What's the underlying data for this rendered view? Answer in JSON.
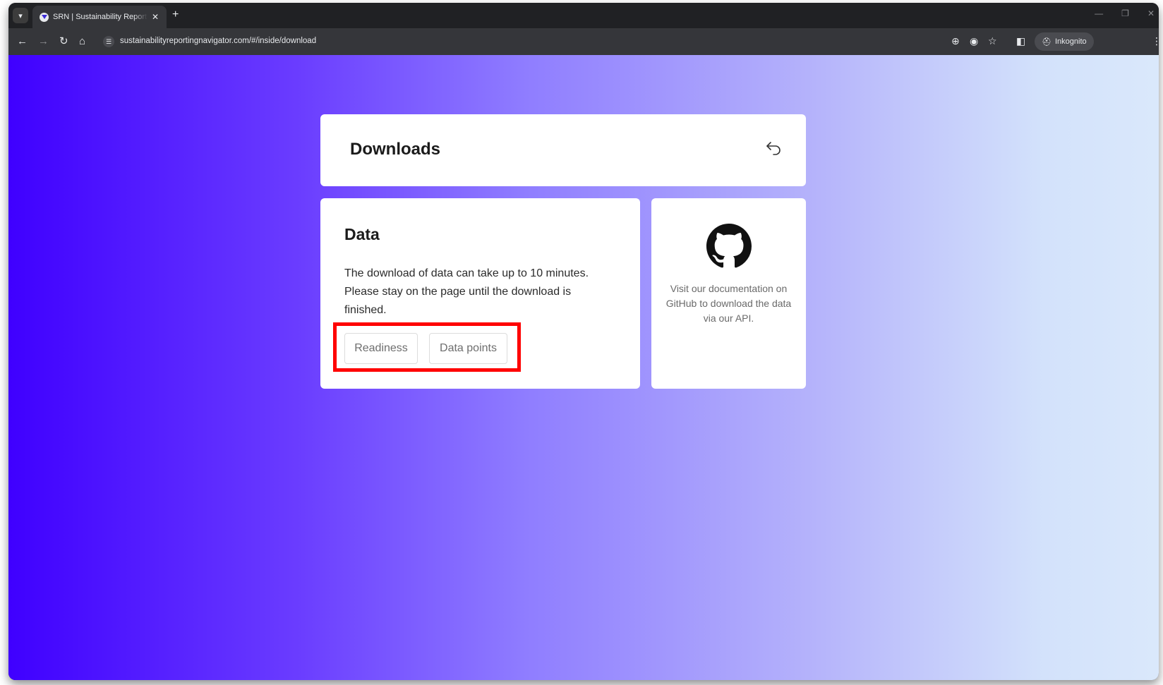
{
  "browser": {
    "tab": {
      "title": "SRN | Sustainability Reporting N",
      "close": "✕"
    },
    "new_tab": "+",
    "url": "sustainabilityreportingnavigator.com/#/inside/download",
    "incognito_label": "Inkognito",
    "icons": {
      "tab_menu": "chevron-down-icon",
      "back": "back-arrow-icon",
      "forward": "forward-arrow-icon",
      "reload": "reload-icon",
      "home": "home-icon",
      "site_info": "site-info-icon",
      "zoom": "zoom-icon",
      "eye": "eye-icon",
      "bookmark": "star-icon",
      "side_panel": "side-panel-icon",
      "incognito": "incognito-icon",
      "menu": "more-vertical-icon"
    }
  },
  "page": {
    "header_title": "Downloads",
    "data_card": {
      "title": "Data",
      "description": "The download of data can take up to 10 minutes. Please stay on the page until the download is finished.",
      "buttons": [
        "Readiness",
        "Data points"
      ]
    },
    "github_card": {
      "text": "Visit our documentation on GitHub to download the data via our API."
    }
  },
  "colors": {
    "gradient_start": "#3f00ff",
    "gradient_end": "#dae8fb",
    "highlight": "#ff0000"
  }
}
